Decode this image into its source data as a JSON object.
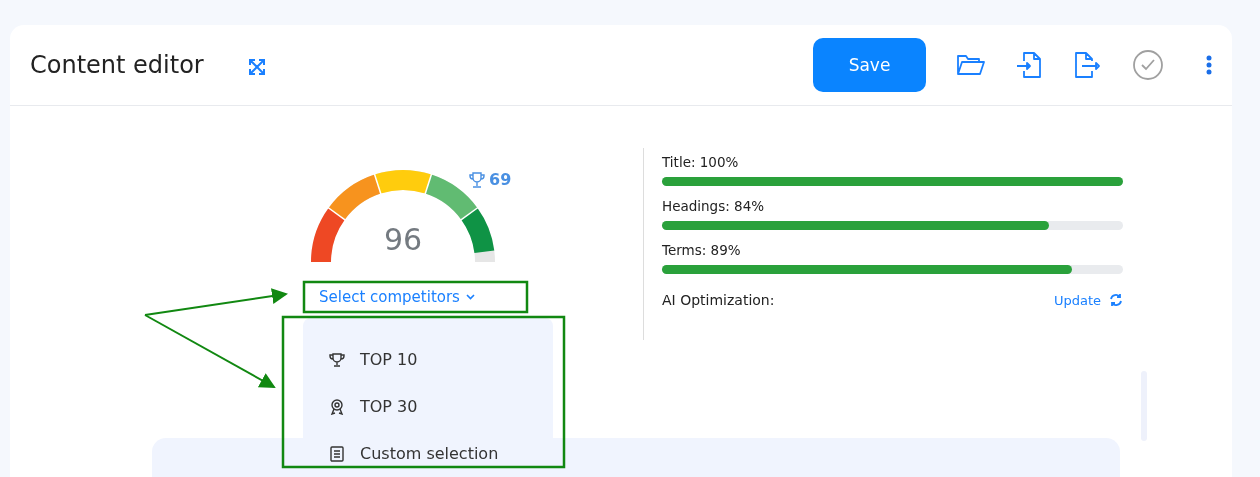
{
  "header": {
    "title": "Content editor",
    "save_button": "Save"
  },
  "score": {
    "value": "96",
    "competitor_score": "69"
  },
  "competitors_button": {
    "label": "Select competitors"
  },
  "competitors_menu": [
    {
      "kind": "trophy",
      "label": "TOP 10"
    },
    {
      "kind": "award",
      "label": "TOP 30"
    },
    {
      "kind": "list",
      "label": "Custom selection"
    }
  ],
  "metrics": [
    {
      "label": "Title: 100%",
      "level": 1.0
    },
    {
      "label": "Headings: 84%",
      "level": 0.84
    },
    {
      "label": "Terms: 89%",
      "level": 0.89
    }
  ],
  "ai_optimization": {
    "label": "AI Optimization:",
    "action": "Update"
  }
}
